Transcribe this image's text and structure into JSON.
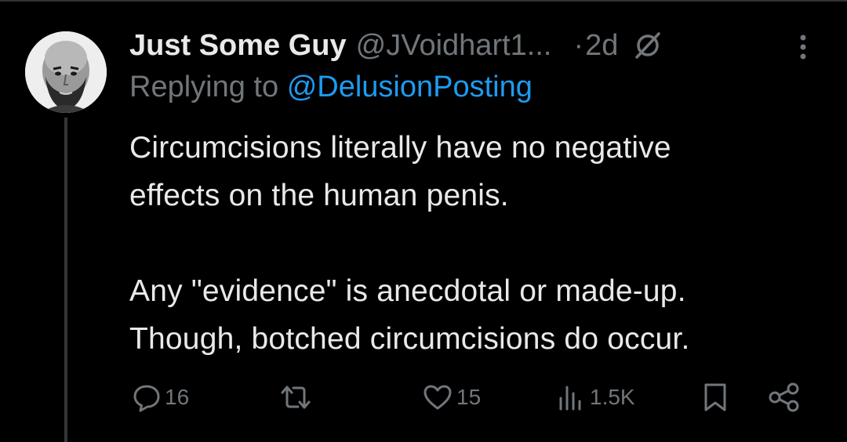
{
  "tweet": {
    "author": {
      "display_name": "Just Some Guy",
      "handle": "@JVoidhart1...",
      "avatar_icon": "bald-man-avatar"
    },
    "separator": "·",
    "time": "2d",
    "grok_icon": "grok-icon",
    "more_icon": "more-vertical-icon",
    "replying_prefix": "Replying to",
    "replying_to": "@DelusionPosting",
    "text_lines": [
      "Circumcisions literally have no negative",
      "effects on the human penis.",
      "",
      "Any \"evidence\" is anecdotal or made-up.",
      "Though, botched circumcisions do occur."
    ]
  },
  "actions": {
    "reply": {
      "icon": "reply-icon",
      "count": "16"
    },
    "retweet": {
      "icon": "retweet-icon",
      "count": ""
    },
    "like": {
      "icon": "heart-icon",
      "count": "15"
    },
    "views": {
      "icon": "views-icon",
      "count": "1.5K"
    },
    "bookmark": {
      "icon": "bookmark-icon"
    },
    "share": {
      "icon": "share-icon"
    }
  },
  "colors": {
    "background": "#000000",
    "text_primary": "#e7e9ea",
    "text_secondary": "#71767b",
    "link": "#1d9bf0",
    "divider": "#2f3336"
  }
}
